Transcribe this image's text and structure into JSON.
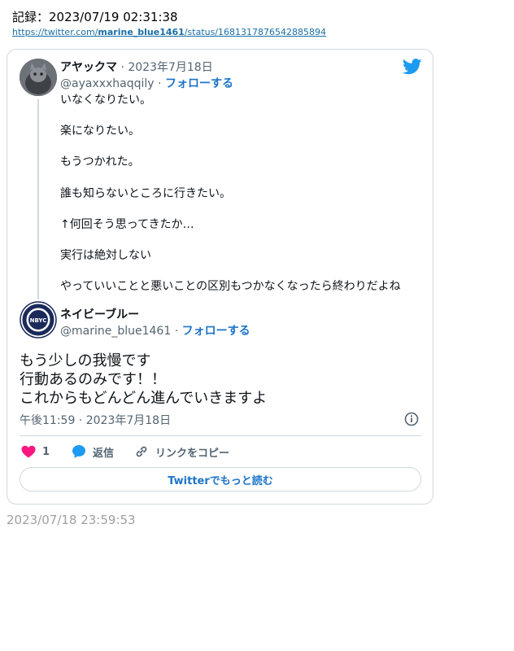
{
  "record": {
    "label": "記録：2023/07/19 02:31:38"
  },
  "url": {
    "prefix": "https://twitter.com/",
    "user": "marine_blue1461",
    "suffix": "/status/1681317876542885894"
  },
  "quoted_tweet": {
    "display_name": "アヤックマ",
    "date": "2023年7月18日",
    "handle": "@ayaxxxhaqqily",
    "follow_label": "フォローする",
    "lines": [
      "いなくなりたい。",
      "楽になりたい。",
      "もうつかれた。",
      "誰も知らないところに行きたい。",
      "↑何回そう思ってきたか…",
      "実行は絶対しない",
      "やっていいことと悪いことの区別もつかなくなったら終わりだよね"
    ]
  },
  "tweet": {
    "display_name": "ネイビーブルー",
    "handle": "@marine_blue1461",
    "follow_label": "フォローする",
    "avatar_text": "NBYC",
    "lines": [
      "もう少しの我慢です",
      "行動あるのみです！！",
      "これからもどんどん進んでいきますよ"
    ],
    "time": "午後11:59",
    "date": "2023年7月18日"
  },
  "actions": {
    "like_count": "1",
    "reply_label": "返信",
    "copy_link_label": "リンクをコピー",
    "read_more_label": "Twitterでもっと読む"
  },
  "footer": {
    "date": "2023/07/18 23:59:53"
  },
  "colors": {
    "accent": "#1d74c8",
    "like": "#f91880",
    "twitter_blue": "#1d9bf0",
    "border": "#cfd9de"
  },
  "icons": [
    "twitter-bird-icon",
    "heart-icon",
    "reply-bubble-icon",
    "link-icon",
    "info-icon"
  ]
}
